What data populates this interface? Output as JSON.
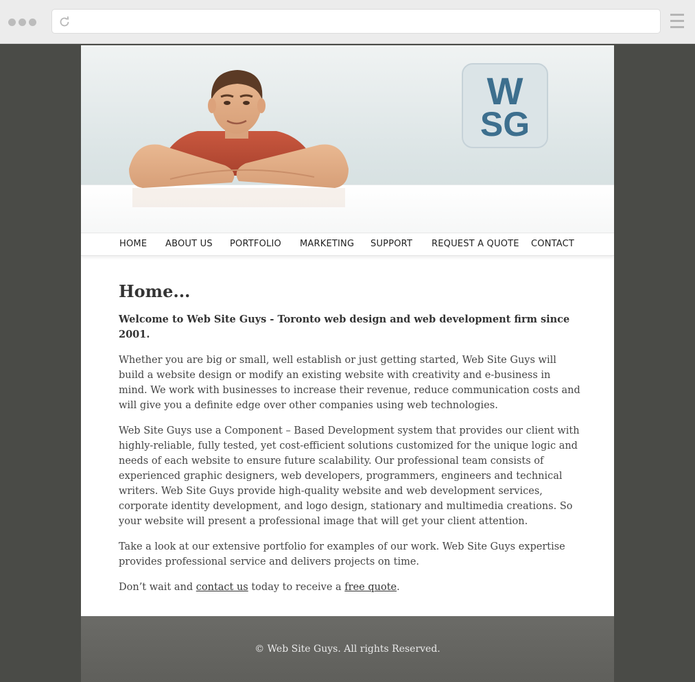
{
  "nav": {
    "items": [
      "HOME",
      "ABOUT US",
      "PORTFOLIO",
      "MARKETING",
      "SUPPORT",
      "REQUEST A QUOTE",
      "CONTACT"
    ]
  },
  "logo": {
    "line1": "W",
    "line2": "SG",
    "color": "#3d6f8e"
  },
  "main": {
    "title": "Home...",
    "lead": "Welcome to Web Site Guys - Toronto web design and web development firm since 2001.",
    "paragraph1": "Whether you are big or small, well establish or just getting started, Web Site Guys will build a website design or modify an existing website with creativity and e-business in mind. We work with businesses to increase their revenue, reduce communication costs and will give you a definite edge over other companies using web technologies.",
    "paragraph2": "Web Site Guys use a Component – Based Development system that provides our client with highly-reliable, fully tested, yet cost-efficient solutions customized for the unique logic and needs of each website to ensure future scalability. Our professional team consists of experienced graphic designers, web developers, programmers, engineers and technical writers. Web Site Guys provide high-quality website and web development services, corporate identity development, and logo design, stationary and multimedia creations. So your website will present a professional image that will get your client attention.",
    "paragraph3": "Take a look at our extensive portfolio for examples of our work. Web Site Guys expertise provides professional service and delivers projects on time.",
    "paragraph4_before": "Don’t wait and ",
    "contact_link": "contact us",
    "paragraph4_middle": " today to receive a ",
    "quote_link": "free quote",
    "paragraph4_after": "."
  },
  "footer": {
    "copyright": "© Web Site Guys. All rights Reserved."
  }
}
